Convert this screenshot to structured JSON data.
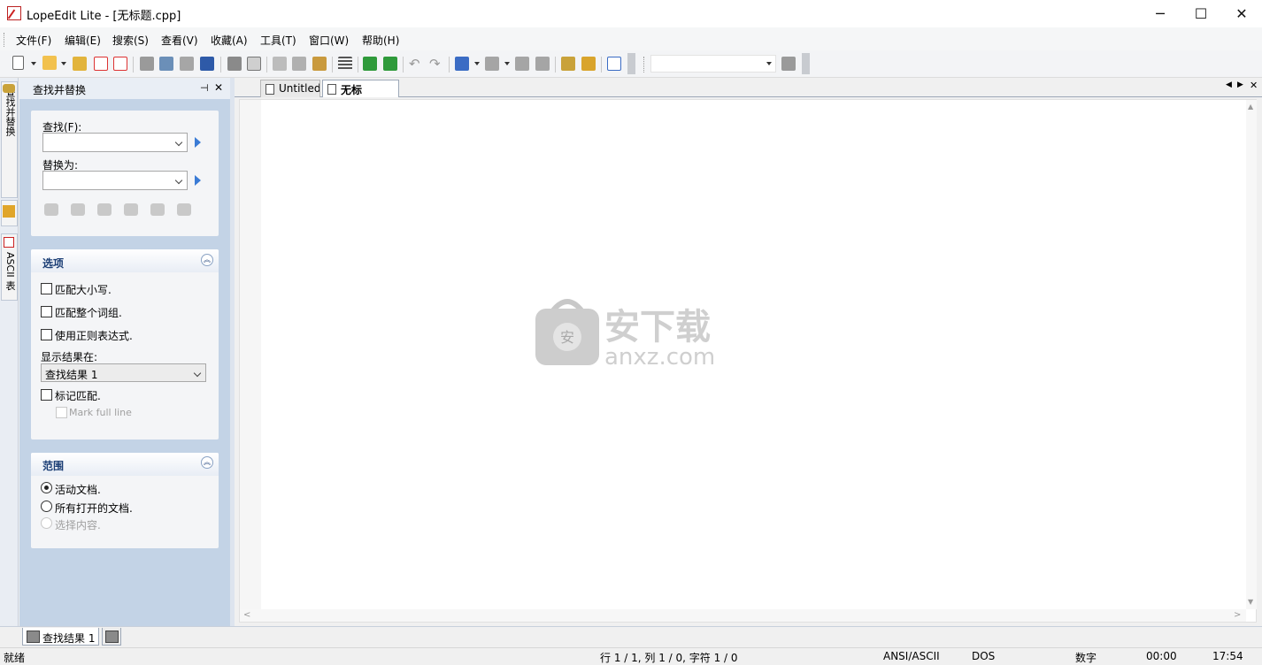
{
  "window": {
    "title": "LopeEdit Lite - [无标题.cpp]",
    "minimize": "─",
    "maximize": "☐",
    "close": "✕"
  },
  "menu": [
    "文件(F)",
    "编辑(E)",
    "搜索(S)",
    "查看(V)",
    "收藏(A)",
    "工具(T)",
    "窗口(W)",
    "帮助(H)"
  ],
  "side_tabs": {
    "find_replace": "查找并替换",
    "ascii": "ASCII 表"
  },
  "panel": {
    "title": "查找并替换",
    "pin": "⊣",
    "close": "✕",
    "find_label": "查找(F):",
    "find_value": "",
    "replace_label": "替换为:",
    "replace_value": "",
    "options": {
      "title": "选项",
      "match_case": "匹配大小写.",
      "whole_word": "匹配整个词组.",
      "regex": "使用正则表达式.",
      "show_results_label": "显示结果在:",
      "show_results_value": "查找结果 1",
      "mark_matches": "标记匹配.",
      "mark_full_line": "Mark full line"
    },
    "scope": {
      "title": "范围",
      "active_doc": "活动文档.",
      "all_open": "所有打开的文档.",
      "selection": "选择内容."
    }
  },
  "doc_tabs": [
    {
      "label": "Untitled",
      "active": false
    },
    {
      "label": "无标题.cpp",
      "active": true
    }
  ],
  "bottom_tab": "查找结果 1",
  "status": {
    "ready": "就绪",
    "position": "行 1 / 1, 列 1 / 0, 字符 1 / 0",
    "encoding": "ANSI/ASCII",
    "line_ending": "DOS",
    "numlock": "数字",
    "time1": "00:00",
    "time2": "17:54"
  },
  "watermark": {
    "cn": "安下载",
    "url": "anxz.com",
    "badge": "安"
  },
  "colors": {
    "panel_bg": "#c3d3e6",
    "card_title": "#1b3e75",
    "accent": "#3a7bd5"
  }
}
